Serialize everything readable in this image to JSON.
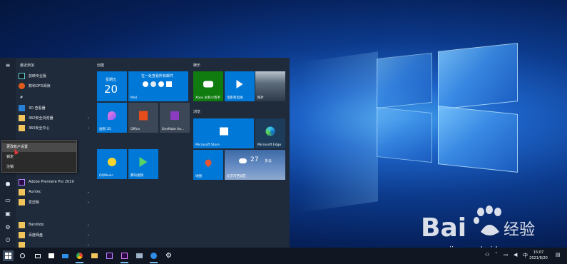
{
  "start_menu": {
    "recent_header": "最近添加",
    "recent": [
      {
        "label": "剪映专业版",
        "icon": "jianying-icon",
        "color": "#101820"
      },
      {
        "label": "数科OFD阅读",
        "icon": "ofd-reader-icon",
        "color": "#e05a1b"
      }
    ],
    "hash_header": "#",
    "apps": [
      {
        "label": "3D 查看器",
        "icon": "3d-viewer-icon",
        "color": "#2a7fd6",
        "chevron": false
      },
      {
        "label": "360安全浏览器",
        "icon": "folder-icon",
        "color": "#f1c55b",
        "chevron": true
      },
      {
        "label": "360安全中心",
        "icon": "folder-icon",
        "color": "#f1c55b",
        "chevron": true
      },
      {
        "label": "Adobe Premiere Pro 2019",
        "icon": "premiere-icon",
        "color": "#2a0a45",
        "chevron": false
      },
      {
        "label": "Auntec",
        "icon": "folder-icon",
        "color": "#f1c55b",
        "chevron": true
      },
      {
        "label": "爱剪辑",
        "icon": "folder-icon",
        "color": "#f1c55b",
        "chevron": true
      },
      {
        "label": "Bandizip",
        "icon": "folder-icon",
        "color": "#f1c55b",
        "chevron": true
      },
      {
        "label": "百度网盘",
        "icon": "folder-icon",
        "color": "#f1c55b",
        "chevron": true
      },
      {
        "label": "",
        "icon": "folder-icon",
        "color": "#f1c55b",
        "chevron": true
      }
    ],
    "context_menu": [
      {
        "label": "更改帐户设置",
        "hover": true
      },
      {
        "label": "锁定",
        "hover": false
      },
      {
        "label": "注销",
        "hover": false
      }
    ],
    "groups": {
      "create": "创建",
      "play": "娱乐",
      "browse": "浏览"
    },
    "tiles": {
      "calendar_day": "星期五",
      "calendar_date": "20",
      "mail_top": "在一处查看所有邮件",
      "mail_label": "Mail",
      "paint3d": "画图 3D",
      "office": "Office",
      "onenote": "OneNote for...",
      "xbox": "Xbox 主机小帮手",
      "movies": "电影和电视",
      "photos": "照片",
      "store": "Microsoft Store",
      "edge": "Microsoft Edge",
      "maps": "地图",
      "weather_temp": "27",
      "weather_desc": "多云",
      "weather_city": "北京市西城区",
      "qqmusic": "QQMusic",
      "tencent_video": "腾讯视频"
    }
  },
  "taskbar": {
    "time": "15:07",
    "date": "2021/8/20"
  },
  "watermark": {
    "brand": "Bai",
    "brand_cn": "经验",
    "url": "jingyan.baidu.com"
  },
  "colors": {
    "accent": "#0078d7",
    "menu_bg": "#1f2a3a",
    "taskbar_bg": "#101722"
  }
}
